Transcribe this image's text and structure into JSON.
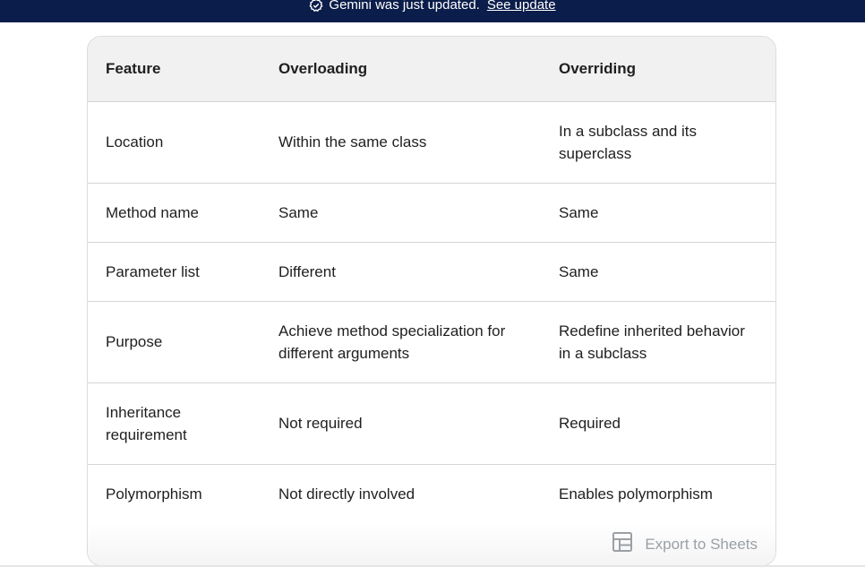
{
  "banner": {
    "message": "Gemini was just updated.",
    "link_label": "See update",
    "icon": "badge-check-icon",
    "background": "#0b1d4a"
  },
  "table": {
    "headers": [
      "Feature",
      "Overloading",
      "Overriding"
    ],
    "rows": [
      {
        "feature": "Location",
        "overloading": "Within the same class",
        "overriding": "In a subclass and its superclass"
      },
      {
        "feature": "Method name",
        "overloading": "Same",
        "overriding": "Same"
      },
      {
        "feature": "Parameter list",
        "overloading": "Different",
        "overriding": "Same"
      },
      {
        "feature": "Purpose",
        "overloading": "Achieve method specialization for different arguments",
        "overriding": "Redefine inherited behavior in a subclass"
      },
      {
        "feature": "Inheritance requirement",
        "overloading": "Not required",
        "overriding": "Required"
      },
      {
        "feature": "Polymorphism",
        "overloading": "Not directly involved",
        "overriding": "Enables polymorphism"
      }
    ]
  },
  "export": {
    "label": "Export to Sheets",
    "icon": "table-icon"
  }
}
